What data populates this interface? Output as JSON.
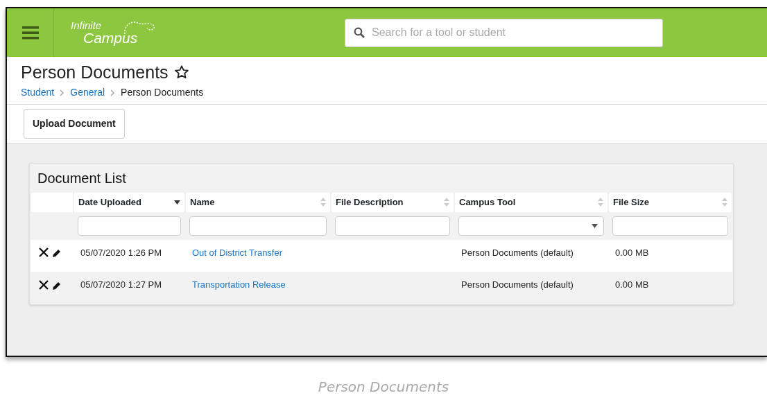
{
  "header": {
    "logo": {
      "line_1": "Infinite",
      "line_2": "Campus"
    },
    "search": {
      "placeholder": "Search for a tool or student"
    }
  },
  "page": {
    "title": "Person Documents",
    "favorite": false,
    "breadcrumbs": [
      {
        "label": "Student",
        "current": false
      },
      {
        "label": "General",
        "current": false
      },
      {
        "label": "Person Documents",
        "current": true
      }
    ]
  },
  "toolbar": {
    "buttons": [
      "Upload Document"
    ]
  },
  "document_list": {
    "title": "Document List",
    "columns": [
      {
        "label": "Date Uploaded",
        "sorted": true,
        "kind": "text"
      },
      {
        "label": "Name",
        "sorted": false,
        "kind": "text"
      },
      {
        "label": "File Description",
        "sorted": false,
        "kind": "text"
      },
      {
        "label": "Campus Tool",
        "sorted": false,
        "kind": "select"
      },
      {
        "label": "File Size",
        "sorted": false,
        "kind": "text"
      }
    ],
    "rows": [
      {
        "date_uploaded": "05/07/2020 1:26 PM",
        "name": "Out of District Transfer",
        "campus_tool": "Person Documents (default)",
        "file_size": "0.00 MB"
      },
      {
        "date_uploaded": "05/07/2020 1:27 PM",
        "name": "Transportation Release",
        "campus_tool": "Person Documents (default)",
        "file_size": "0.00 MB"
      }
    ]
  },
  "caption": "Person Documents"
}
